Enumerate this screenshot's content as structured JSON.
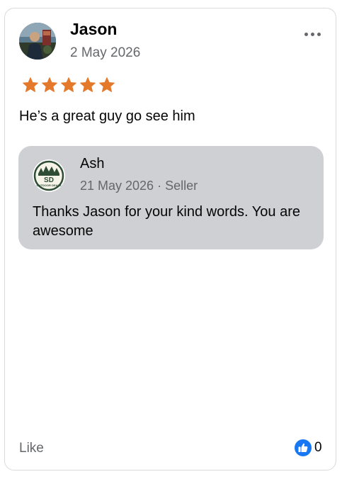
{
  "review": {
    "author": "Jason",
    "date": "2 May 2026",
    "rating": 5,
    "rating_max": 5,
    "text": "He’s a great guy go see him",
    "more_icon": "more-horizontal-icon"
  },
  "reply": {
    "author": "Ash",
    "meta": "21 May 2026 · Seller",
    "logo_text": "SD",
    "logo_subtext": "OUTDOOR DEALS",
    "text": "Thanks Jason for your kind words. You are awesome"
  },
  "footer": {
    "like_label": "Like",
    "like_count": "0",
    "like_icon": "thumbs-up-icon"
  },
  "colors": {
    "star": "#e4792b",
    "reply_background": "#ced0d4",
    "like_badge": "#1877f2",
    "secondary_text": "#65676b"
  }
}
